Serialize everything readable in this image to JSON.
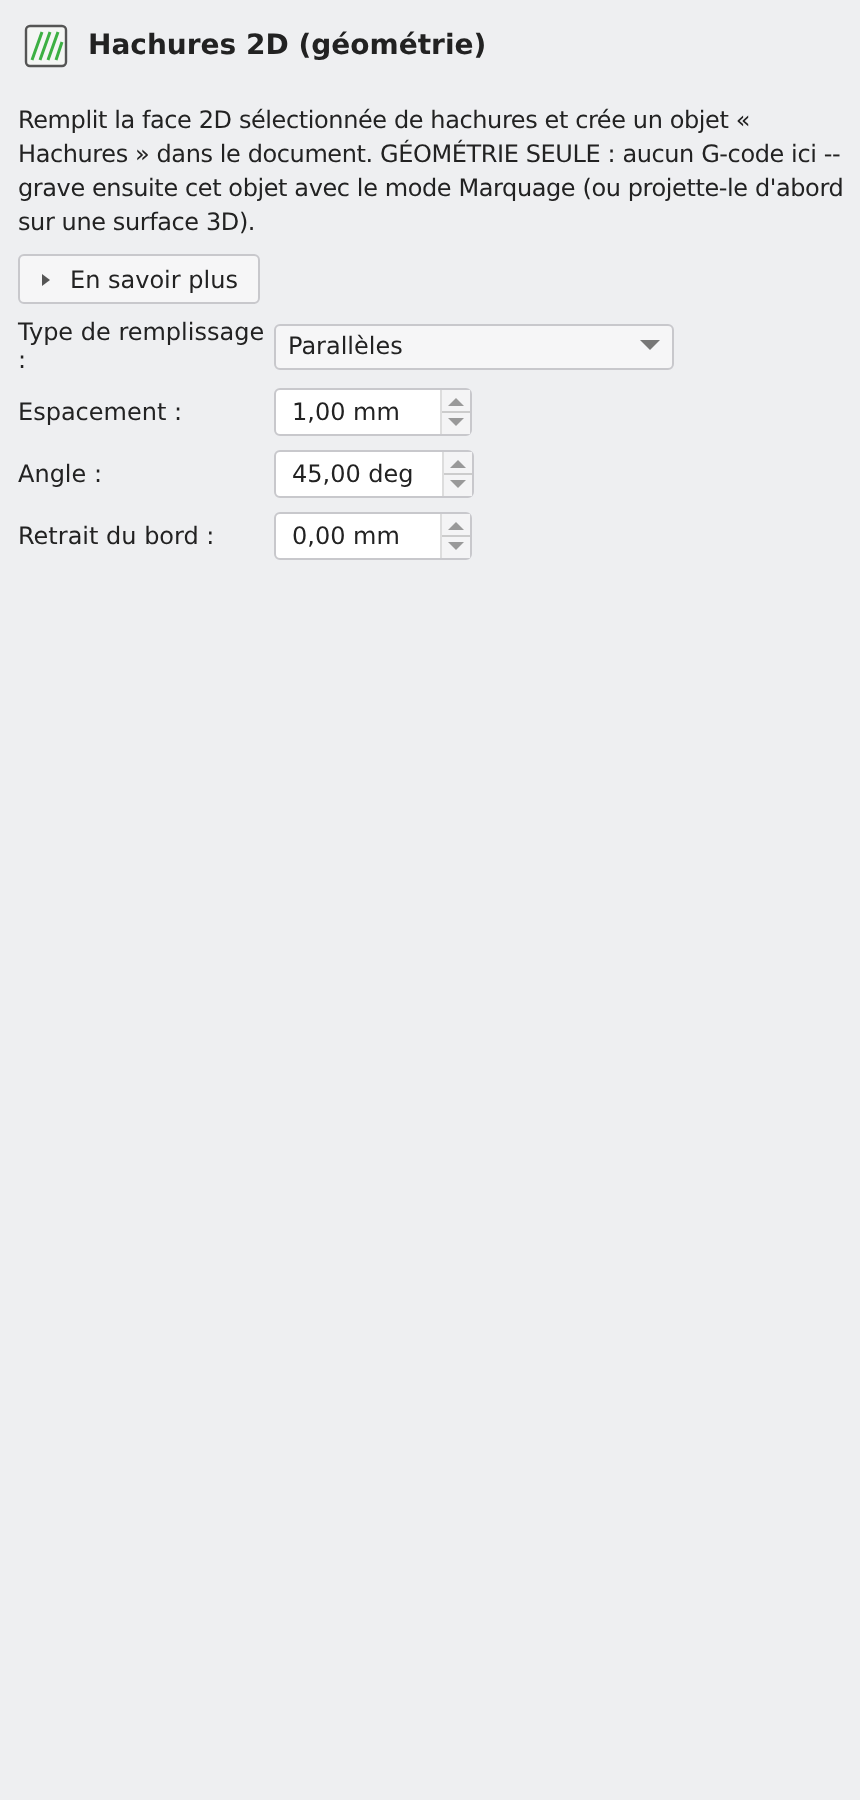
{
  "header": {
    "title": "Hachures 2D (géométrie)"
  },
  "description": "Remplit la face 2D sélectionnée de hachures et crée un objet « Hachures » dans le document. GÉOMÉTRIE SEULE : aucun G-code ici -- grave ensuite cet objet avec le mode Marquage (ou projette-le d'abord sur une surface 3D).",
  "more_button": {
    "label": "En savoir plus",
    "expanded": false
  },
  "fields": [
    {
      "kind": "combo",
      "label": "Type de remplissage :",
      "value": "Parallèles"
    },
    {
      "kind": "spin",
      "label": "Espacement :",
      "value": "1,00 mm"
    },
    {
      "kind": "spin",
      "label": "Angle :",
      "value": "45,00 deg"
    },
    {
      "kind": "spin",
      "label": "Retrait du bord :",
      "value": "0,00 mm"
    }
  ]
}
